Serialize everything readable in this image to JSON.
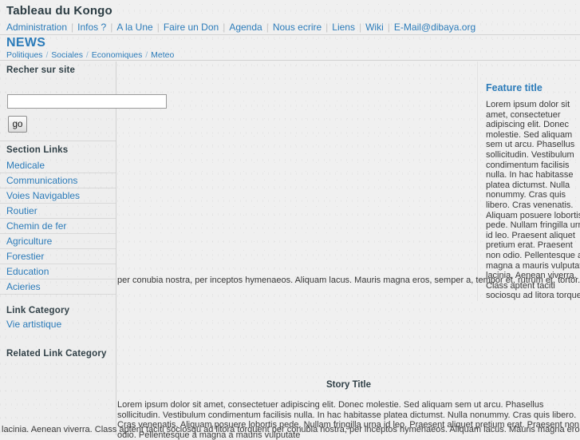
{
  "header": {
    "site_title": "Tableau du Kongo",
    "nav": [
      {
        "label": "Administration"
      },
      {
        "label": "Infos ?"
      },
      {
        "label": "A la Une"
      },
      {
        "label": "Faire un Don"
      },
      {
        "label": "Agenda"
      },
      {
        "label": "Nous ecrire"
      },
      {
        "label": "Liens"
      },
      {
        "label": "Wiki"
      },
      {
        "label": "E-Mail@dibaya.org"
      }
    ],
    "nav_separator": "|"
  },
  "section": {
    "title": "NEWS",
    "subnav": [
      {
        "label": "Politiques"
      },
      {
        "label": "Sociales"
      },
      {
        "label": "Economiques"
      },
      {
        "label": "Meteo"
      }
    ],
    "subnav_separator": "/"
  },
  "sidebar": {
    "search": {
      "heading": "Recher sur site",
      "value": "",
      "placeholder": "",
      "button_label": "go"
    },
    "section_links": {
      "heading": "Section Links",
      "items": [
        {
          "label": "Medicale"
        },
        {
          "label": "Communications"
        },
        {
          "label": "Voies Navigables"
        },
        {
          "label": "Routier"
        },
        {
          "label": "Chemin de fer"
        },
        {
          "label": "Agriculture"
        },
        {
          "label": "Forestier"
        },
        {
          "label": "Education"
        },
        {
          "label": "Acieries"
        }
      ]
    },
    "link_category": {
      "heading": "Link Category",
      "items": [
        {
          "label": "Vie artistique"
        }
      ]
    },
    "related_link_category": {
      "heading": "Related Link Category",
      "items": []
    }
  },
  "feature": {
    "title": "Feature title",
    "body": "Lorem ipsum dolor sit amet, consectetuer adipiscing elit. Donec molestie. Sed aliquam sem ut arcu. Phasellus sollicitudin. Vestibulum condimentum facilisis nulla. In hac habitasse platea dictumst. Nulla nonummy. Cras quis libero. Cras venenatis. Aliquam posuere lobortis pede. Nullam fringilla urna id leo. Praesent aliquet pretium erat. Praesent non odio. Pellentesque a magna a mauris vulputate lacinia. Aenean viverra. Class aptent taciti sociosqu ad litora torquent",
    "overflow_line": "per conubia nostra, per inceptos hymenaeos. Aliquam lacus. Mauris magna eros, semper a, tempor et, rutrum et, tortor."
  },
  "story": {
    "title": "Story Title",
    "body": "Lorem ipsum dolor sit amet, consectetuer adipiscing elit. Donec molestie. Sed aliquam sem ut arcu. Phasellus sollicitudin. Vestibulum condimentum facilisis nulla. In hac habitasse platea dictumst. Nulla nonummy. Cras quis libero. Cras venenatis. Aliquam posuere lobortis pede. Nullam fringilla urna id leo. Praesent aliquet pretium erat. Praesent non odio. Pellentesque a magna a mauris vulputate",
    "overflow_line": "lacinia. Aenean viverra. Class aptent taciti sociosqu ad litora torquent per conubia nostra, per inceptos hymenaeos. Aliquam lacus. Mauris magna eros, semper a,"
  },
  "colors": {
    "link": "#2b7bb9",
    "heading": "#2f3f46",
    "page_bg": "#f0f0f0",
    "sidebar_bg": "#eeeeee"
  }
}
